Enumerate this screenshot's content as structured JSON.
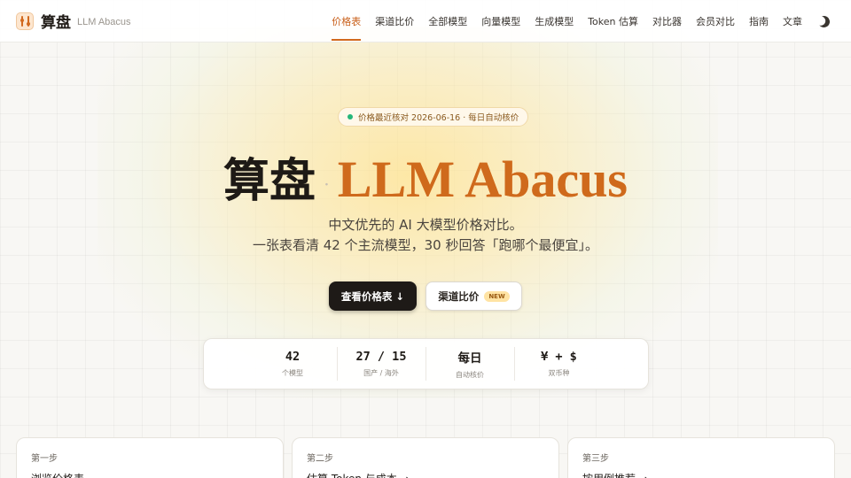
{
  "brand": {
    "name_cn": "算盘",
    "name_en": "LLM Abacus"
  },
  "nav": {
    "items": [
      {
        "label": "价格表",
        "active": true
      },
      {
        "label": "渠道比价",
        "active": false
      },
      {
        "label": "全部模型",
        "active": false
      },
      {
        "label": "向量模型",
        "active": false
      },
      {
        "label": "生成模型",
        "active": false
      },
      {
        "label": "Token 估算",
        "active": false
      },
      {
        "label": "对比器",
        "active": false
      },
      {
        "label": "会员对比",
        "active": false
      },
      {
        "label": "指南",
        "active": false
      },
      {
        "label": "文章",
        "active": false
      }
    ],
    "theme_icon": "moon-icon"
  },
  "hero": {
    "badge": "价格最近核对 2026-06-16 · 每日自动核价",
    "title_cn": "算盘",
    "title_sep": "·",
    "title_en": "LLM Abacus",
    "subtitle_line1": "中文优先的 AI 大模型价格对比。",
    "subtitle_line2": "一张表看清 42 个主流模型，30 秒回答「跑哪个最便宜」。",
    "primary_button": "查看价格表 ↓",
    "secondary_button": "渠道比价",
    "secondary_tag": "NEW"
  },
  "stats": [
    {
      "value": "42",
      "label": "个模型"
    },
    {
      "value": "27 / 15",
      "label": "国产 / 海外"
    },
    {
      "value": "每日",
      "label": "自动核价"
    },
    {
      "value": "¥ + $",
      "label": "双币种"
    }
  ],
  "steps": [
    {
      "step": "第一步",
      "title": "浏览价格表"
    },
    {
      "step": "第二步",
      "title": "估算 Token 与成本 →"
    },
    {
      "step": "第三步",
      "title": "按用例推荐 →"
    }
  ],
  "colors": {
    "accent": "#d2691e",
    "status_dot": "#25b67a",
    "primary_button": "#1e1a17"
  }
}
